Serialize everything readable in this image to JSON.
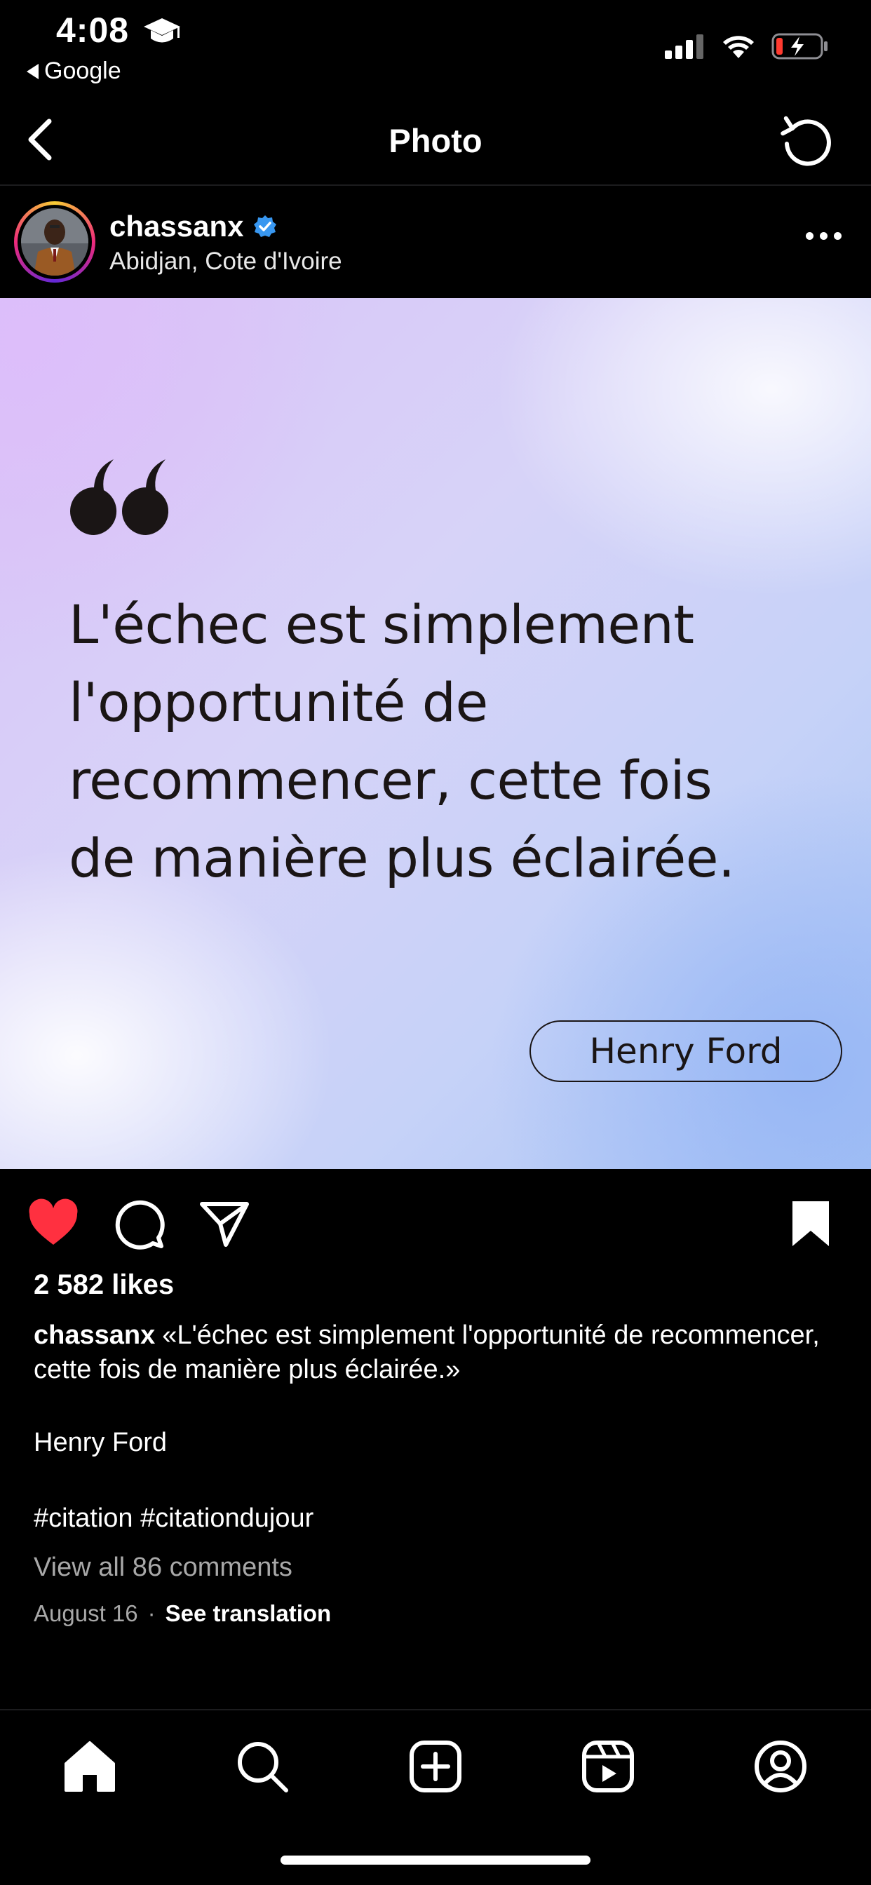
{
  "status_bar": {
    "time": "4:08",
    "back_app": "Google",
    "icons": [
      "graduation-cap-icon",
      "cellular-signal-icon",
      "wifi-icon",
      "battery-charging-icon"
    ]
  },
  "header": {
    "title": "Photo",
    "back_icon": "chevron-left-icon",
    "refresh_icon": "refresh-icon"
  },
  "post": {
    "username": "chassanx",
    "verified": true,
    "location": "Abidjan, Cote d'Ivoire",
    "image": {
      "quote_lines": [
        "L'échec est simplement",
        "l'opportunité de",
        "recommencer, cette fois",
        "de manière plus éclairée."
      ],
      "author": "Henry Ford"
    },
    "liked": true,
    "saved": true,
    "likes": "2 582 likes",
    "caption_user": "chassanx",
    "caption_text": "«L'échec est simplement l'opportunité de recommencer, cette fois de manière plus éclairée.»",
    "caption_author": "Henry Ford",
    "hashtags": "#citation #citationdujour",
    "view_comments": "View all 86 comments",
    "date": "August 16",
    "separator": "·",
    "see_translation": "See translation"
  },
  "bottom_nav": {
    "items": [
      "home-icon",
      "search-icon",
      "create-icon",
      "reels-icon",
      "profile-icon"
    ]
  },
  "colors": {
    "background": "#000000",
    "like_red": "#ff3040",
    "verified_blue": "#3897f0",
    "secondary_text": "#a8a8a8",
    "quote_text": "#1a1515"
  }
}
